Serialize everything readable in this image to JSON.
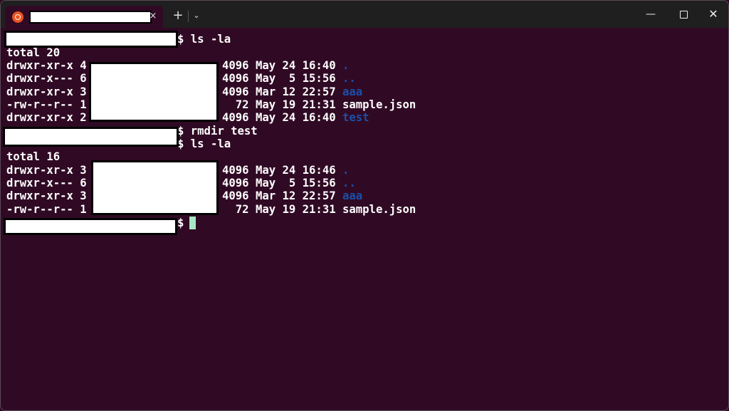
{
  "window": {
    "tab_close": "×",
    "new_tab": "+",
    "tab_menu": "⌄",
    "minimize": "—",
    "close": "✕"
  },
  "icons": {
    "tab_icon": "ubuntu-icon",
    "cursor_color": "#a7e8c4",
    "link_color": "#1c4fa8"
  },
  "terminal": {
    "lines": [
      {
        "prompt_suffix": "$ ls -la"
      },
      {
        "text": "total 20"
      },
      {
        "perm": "drwxr-xr-x 4",
        "rest": "4096 May 24 16:40 ",
        "name": ".",
        "dir": true
      },
      {
        "perm": "drwxr-x--- 6",
        "rest": "4096 May  5 15:56 ",
        "name": "..",
        "dir": true
      },
      {
        "perm": "drwxr-xr-x 3",
        "rest": "4096 Mar 12 22:57 ",
        "name": "aaa",
        "dir": true
      },
      {
        "perm": "-rw-r--r-- 1",
        "rest": "  72 May 19 21:31 ",
        "name": "sample.json",
        "dir": false
      },
      {
        "perm": "drwxr-xr-x 2",
        "rest": "4096 May 24 16:40 ",
        "name": "test",
        "dir": true
      },
      {
        "prompt_suffix": "$ rmdir test"
      },
      {
        "prompt_suffix": "$ ls -la"
      },
      {
        "text": "total 16"
      },
      {
        "perm": "drwxr-xr-x 3",
        "rest": "4096 May 24 16:46 ",
        "name": ".",
        "dir": true
      },
      {
        "perm": "drwxr-x--- 6",
        "rest": "4096 May  5 15:56 ",
        "name": "..",
        "dir": true
      },
      {
        "perm": "drwxr-xr-x 3",
        "rest": "4096 Mar 12 22:57 ",
        "name": "aaa",
        "dir": true
      },
      {
        "perm": "-rw-r--r-- 1",
        "rest": "  72 May 19 21:31 ",
        "name": "sample.json",
        "dir": false
      },
      {
        "prompt_suffix": "$ "
      }
    ]
  }
}
